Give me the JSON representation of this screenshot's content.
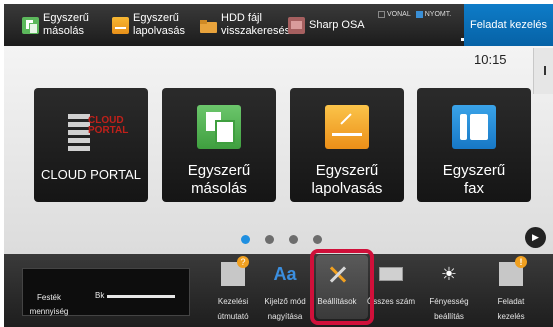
{
  "topbar": {
    "shortcuts": [
      {
        "icon": "copy-icon",
        "line1": "Egyszerű",
        "line2": "másolás"
      },
      {
        "icon": "scan-icon",
        "line1": "Egyszerű",
        "line2": "lapolvasás"
      },
      {
        "icon": "folder-icon",
        "line1": "HDD fájl",
        "line2": "visszakeresés"
      },
      {
        "icon": "osa-icon",
        "line1": "Sharp OSA",
        "line2": ""
      }
    ],
    "indicators": [
      {
        "label": "VONAL",
        "active": false
      },
      {
        "label": "NYOMT.",
        "active": true
      }
    ],
    "job_status_label": "Feladat kezelés"
  },
  "main": {
    "clock": "10:15",
    "tiles": [
      {
        "icon": "cloud-portal-logo",
        "logo_line1": "CLOUD",
        "logo_line2": "PORTAL",
        "line1": "CLOUD PORTAL",
        "line2": ""
      },
      {
        "icon": "copy-icon",
        "line1": "Egyszerű",
        "line2": "másolás"
      },
      {
        "icon": "scan-icon",
        "line1": "Egyszerű",
        "line2": "lapolvasás"
      },
      {
        "icon": "fax-icon",
        "line1": "Egyszerű",
        "line2": "fax"
      }
    ],
    "pages": {
      "count": 4,
      "current": 1
    }
  },
  "bottombar": {
    "toner": {
      "line1": "Festék",
      "line2": "mennyiség",
      "color": "Bk"
    },
    "items": [
      {
        "icon": "guide-icon",
        "line1": "Kezelési",
        "line2": "útmutató"
      },
      {
        "icon": "display-zoom-icon",
        "icon_text": "Aa",
        "line1": "Kijelző mód",
        "line2": "nagyítása"
      },
      {
        "icon": "settings-icon",
        "line1": "Beállítások",
        "line2": ""
      },
      {
        "icon": "counter-icon",
        "line1": "Összes szám",
        "line2": ""
      },
      {
        "icon": "brightness-icon",
        "icon_text": "☀",
        "line1": "Fényesség",
        "line2": "beállítás"
      },
      {
        "icon": "job-status-icon",
        "line1": "Feladat",
        "line2": "kezelés"
      }
    ]
  },
  "colors": {
    "highlight": "#d0103a",
    "active_page": "#1f8fe0",
    "job_button": "#0e7cc8"
  }
}
